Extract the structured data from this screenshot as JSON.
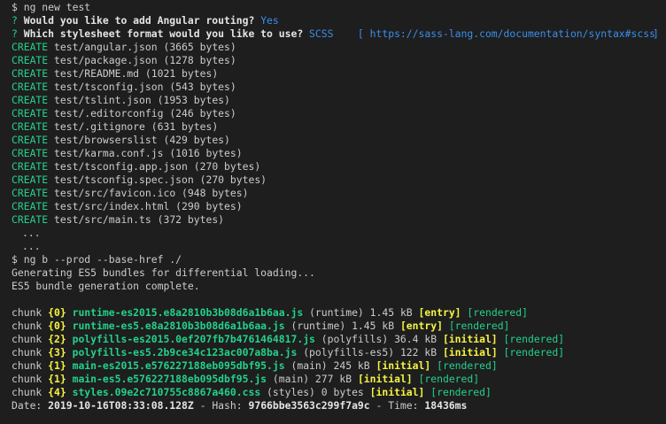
{
  "prompt": "$",
  "session1": {
    "command": "ng new test",
    "q1": {
      "mark": "?",
      "question": "Would you like to add Angular routing?",
      "answer": "Yes"
    },
    "q2": {
      "mark": "?",
      "question": "Which stylesheet format would you like to use?",
      "answer": "SCSS",
      "link_open": "[",
      "link": "https://sass-lang.com/documentation/syntax#scss",
      "link_close": "]"
    },
    "create_label": "CREATE",
    "creates": [
      "test/angular.json (3665 bytes)",
      "test/package.json (1278 bytes)",
      "test/README.md (1021 bytes)",
      "test/tsconfig.json (543 bytes)",
      "test/tslint.json (1953 bytes)",
      "test/.editorconfig (246 bytes)",
      "test/.gitignore (631 bytes)",
      "test/browserslist (429 bytes)",
      "test/karma.conf.js (1016 bytes)",
      "test/tsconfig.app.json (270 bytes)",
      "test/tsconfig.spec.json (270 bytes)",
      "test/src/favicon.ico (948 bytes)",
      "test/src/index.html (290 bytes)",
      "test/src/main.ts (372 bytes)"
    ],
    "ellipsis": [
      "...",
      "..."
    ]
  },
  "session2": {
    "command": "ng b --prod --base-href ./",
    "out1": "Generating ES5 bundles for differential loading...",
    "out2": "ES5 bundle generation complete.",
    "chunk_label": "chunk",
    "chunks": [
      {
        "id": "{0}",
        "file": "runtime-es2015.e8a2810b3b08d6a1b6aa.js",
        "name": "(runtime)",
        "size": "1.45 kB",
        "tag": "[entry]",
        "status": "[rendered]"
      },
      {
        "id": "{0}",
        "file": "runtime-es5.e8a2810b3b08d6a1b6aa.js",
        "name": "(runtime)",
        "size": "1.45 kB",
        "tag": "[entry]",
        "status": "[rendered]"
      },
      {
        "id": "{2}",
        "file": "polyfills-es2015.0ef207fb7b4761464817.js",
        "name": "(polyfills)",
        "size": "36.4 kB",
        "tag": "[initial]",
        "status": "[rendered]"
      },
      {
        "id": "{3}",
        "file": "polyfills-es5.2b9ce34c123ac007a8ba.js",
        "name": "(polyfills-es5)",
        "size": "122 kB",
        "tag": "[initial]",
        "status": "[rendered]"
      },
      {
        "id": "{1}",
        "file": "main-es2015.e576227188eb095dbf95.js",
        "name": "(main)",
        "size": "245 kB",
        "tag": "[initial]",
        "status": "[rendered]"
      },
      {
        "id": "{1}",
        "file": "main-es5.e576227188eb095dbf95.js",
        "name": "(main)",
        "size": "277 kB",
        "tag": "[initial]",
        "status": "[rendered]"
      },
      {
        "id": "{4}",
        "file": "styles.09e2c710755c8867a460.css",
        "name": "(styles)",
        "size": "0 bytes",
        "tag": "[initial]",
        "status": "[rendered]"
      }
    ],
    "summary": {
      "date_label": "Date:",
      "date": "2019-10-16T08:33:08.128Z",
      "hash_label": "- Hash:",
      "hash": "9766bbe3563c299f7a9c",
      "time_label": "- Time:",
      "time": "18436ms"
    }
  },
  "colors": {
    "background": "#1e1e1e",
    "text": "#cccccc",
    "green": "#23d18b",
    "blue": "#3b8eea",
    "yellow": "#f5f543"
  }
}
